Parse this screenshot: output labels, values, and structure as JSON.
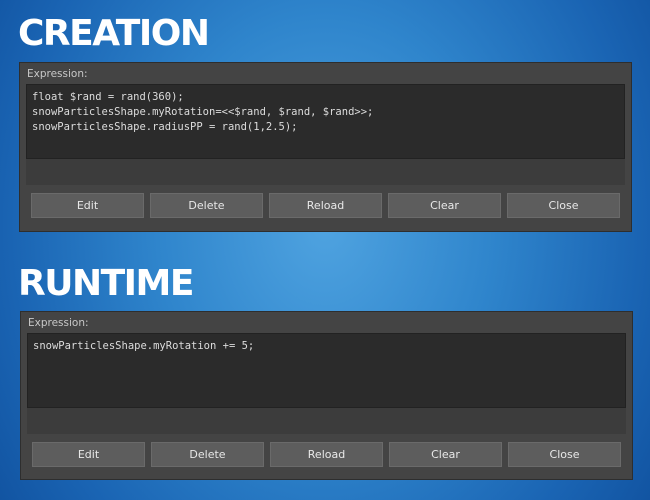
{
  "sections": {
    "creation": {
      "heading": "CREATION",
      "label": "Expression:",
      "code": "float $rand = rand(360);\nsnowParticlesShape.myRotation=<<$rand, $rand, $rand>>;\nsnowParticlesShape.radiusPP = rand(1,2.5);",
      "buttons": {
        "edit": "Edit",
        "delete": "Delete",
        "reload": "Reload",
        "clear": "Clear",
        "close": "Close"
      }
    },
    "runtime": {
      "heading": "RUNTIME",
      "label": "Expression:",
      "code": "snowParticlesShape.myRotation += 5;",
      "buttons": {
        "edit": "Edit",
        "delete": "Delete",
        "reload": "Reload",
        "clear": "Clear",
        "close": "Close"
      }
    }
  },
  "colors": {
    "panel_bg": "#444444",
    "code_bg": "#2b2b2b",
    "button_bg": "#5d5d5d",
    "heading_text": "#ffffff",
    "background_blue": "#2f85cc"
  }
}
